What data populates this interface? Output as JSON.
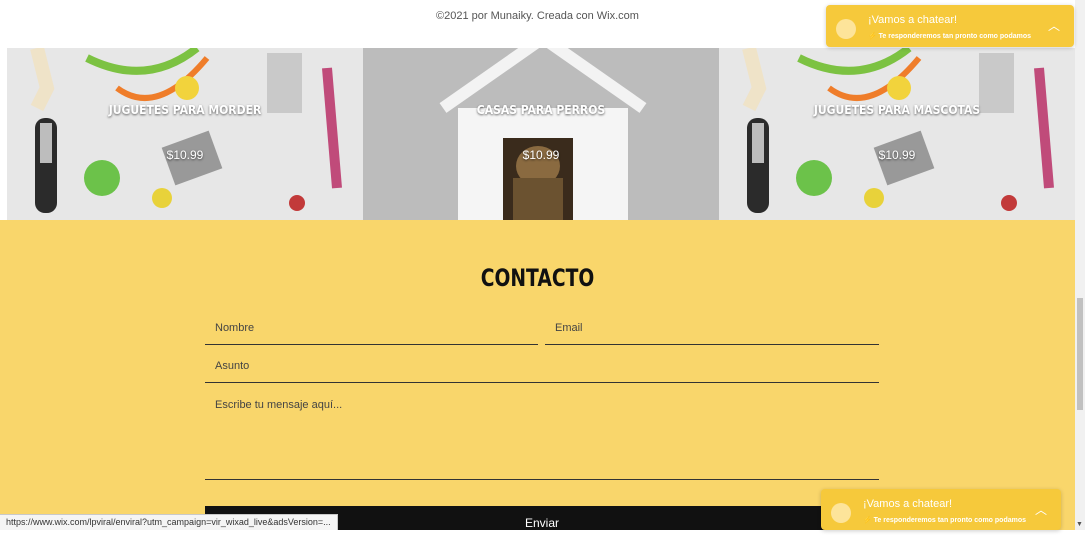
{
  "footer": {
    "copyright": "©2021 por Munaiky. Creada con Wix.com"
  },
  "products": [
    {
      "name": "JUGUETES PARA MORDER",
      "price": "$10.99"
    },
    {
      "name": "CASAS PARA PERROS",
      "price": "$10.99"
    },
    {
      "name": "JUGUETES PARA MASCOTAS",
      "price": "$10.99"
    }
  ],
  "contact": {
    "title": "CONTACTO",
    "name_placeholder": "Nombre",
    "email_placeholder": "Email",
    "subject_placeholder": "Asunto",
    "message_placeholder": "Escribe tu mensaje aquí...",
    "submit_label": "Enviar"
  },
  "chat": {
    "title": "¡Vamos a chatear!",
    "subtitle": "Te responderemos tan pronto como podamos",
    "bolt_icon": "⚡"
  },
  "status_bar": {
    "url": "https://www.wix.com/lpviral/enviral?utm_campaign=vir_wixad_live&adsVersion=..."
  },
  "colors": {
    "contact_bg": "#f9d66b",
    "chat_bg": "#f6c93b",
    "submit_bg": "#111111"
  }
}
